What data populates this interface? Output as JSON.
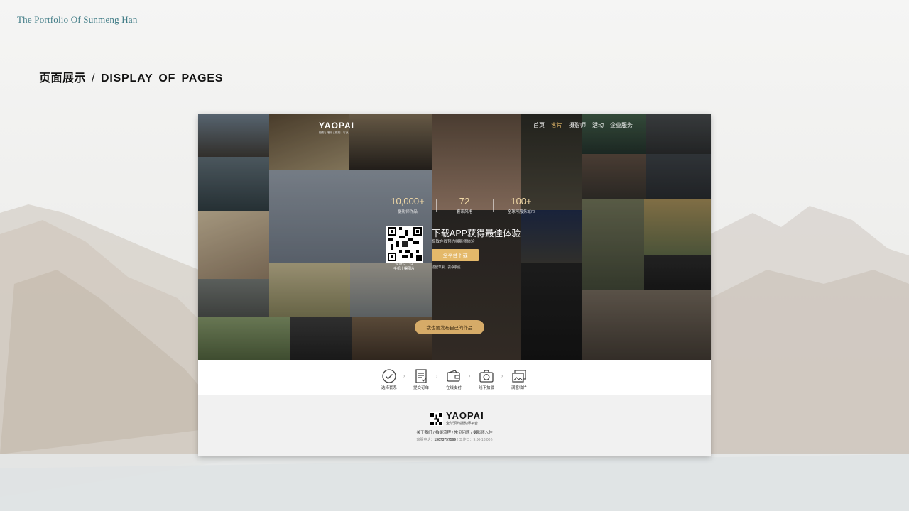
{
  "portfolio_title": "The Portfolio Of Sunmeng Han",
  "section": {
    "cn": "页面展示",
    "separator": "/",
    "en": "DISPLAY  OF  PAGES"
  },
  "site": {
    "logo": "YAOPAI",
    "logo_sub": "摄影 | 婚纱 | 旅拍 | 写真",
    "nav": [
      "首页",
      "客片",
      "摄影师",
      "活动",
      "企业服务"
    ],
    "nav_active": "客片",
    "stats": [
      {
        "num": "10,000+",
        "label": "摄影师作品"
      },
      {
        "num": "72",
        "label": "套系风格"
      },
      {
        "num": "100+",
        "label": "全球可服务城市"
      }
    ],
    "qr_caption": [
      "微信扫一扫",
      "手机上摆图片"
    ],
    "app_title": "下载APP获得最佳体验",
    "app_sub": "极致在线预约摄影师体验",
    "app_download": "全平台下载",
    "app_platforms": "适配苹果、安卓系统",
    "publish": "我也要发布自己的作品",
    "steps": [
      "选择套系",
      "提交订单",
      "在线支付",
      "线下拍摄",
      "满意收片"
    ],
    "footer": {
      "logo": "YAOPAI",
      "tagline": "全球预约摄影师平台",
      "links": [
        "关于我们",
        "拍摄流程",
        "常见问题",
        "摄影师入住"
      ],
      "link_separator": " / ",
      "phone_label": "客服电话：",
      "phone": "13073757569",
      "hours": "( 工作日：9:00-18:00 )"
    }
  },
  "colors": {
    "accent": "#e4b96a",
    "button": "#d6ab68",
    "title_teal": "#3f7b86"
  }
}
